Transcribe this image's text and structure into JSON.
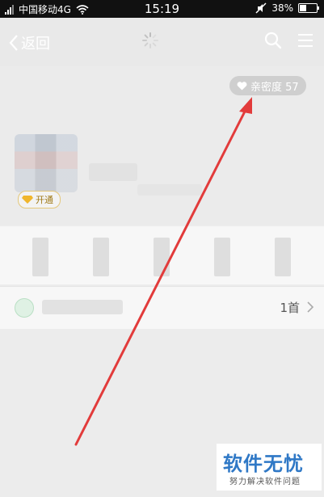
{
  "status_bar": {
    "carrier": "中国移动4G",
    "time": "15:19",
    "battery": "38%",
    "battery_level": 0.38
  },
  "header": {
    "back_label": "返回",
    "icons": [
      "back-icon",
      "loading-spinner-icon",
      "search-icon",
      "menu-icon"
    ]
  },
  "profile": {
    "intimacy_label": "亲密度 57",
    "vip_label": "开通"
  },
  "music": {
    "count": "1首"
  },
  "colors": {
    "arrow": "#e23b3b",
    "watermark_blue": "#2f78c6"
  },
  "watermark": {
    "title": "软件无忧",
    "subtitle": "努力解决软件问题"
  }
}
